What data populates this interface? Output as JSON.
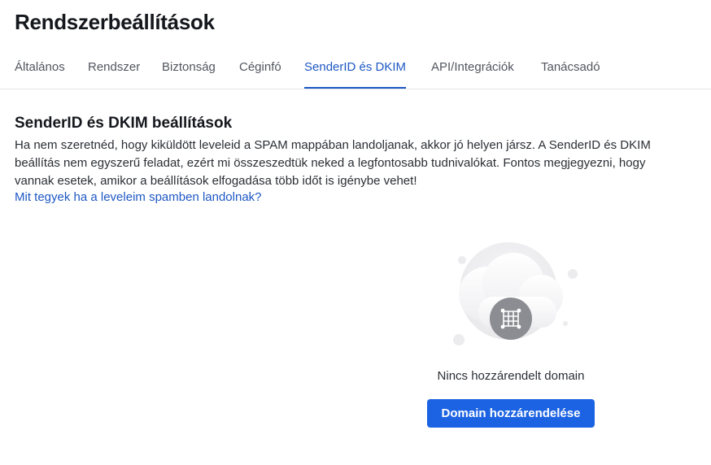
{
  "page": {
    "title": "Rendszerbeállítások"
  },
  "tabs": [
    {
      "label": "Általános"
    },
    {
      "label": "Rendszer"
    },
    {
      "label": "Biztonság"
    },
    {
      "label": "Céginfó"
    },
    {
      "label": "SenderID és DKIM",
      "active": true
    },
    {
      "label": "API/Integrációk"
    },
    {
      "label": "Tanácsadó"
    }
  ],
  "section": {
    "title": "SenderID és DKIM beállítások",
    "description": "Ha nem szeretnéd, hogy kiküldött leveleid a SPAM mappában landoljanak, akkor jó helyen jársz. A SenderID és DKIM beállítás nem egyszerű feladat, ezért mi összeszedtük neked a legfontosabb tudnivalókat. Fontos megjegyezni, hogy vannak esetek, amikor a beállítások elfogadása több időt is igénybe vehet!",
    "help_link": "Mit tegyek ha a leveleim spamben landolnak?"
  },
  "empty_state": {
    "icon": "network-globe-icon",
    "text": "Nincs hozzárendelt domain",
    "button_label": "Domain hozzárendelése"
  },
  "colors": {
    "accent": "#1e58c4",
    "button": "#1c63e3"
  }
}
